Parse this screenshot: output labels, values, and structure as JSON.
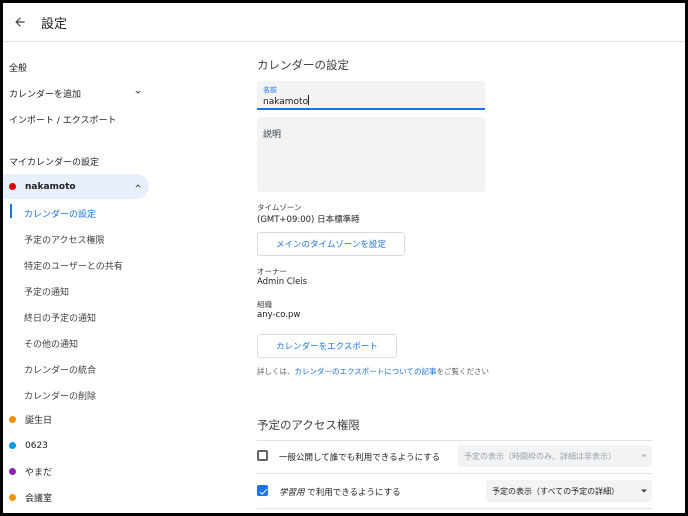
{
  "header": {
    "title": "設定"
  },
  "sidebar": {
    "general": "全般",
    "add_calendar": "カレンダーを追加",
    "import_export": "インポート / エクスポート",
    "my_calendars_heading": "マイカレンダーの設定",
    "active_calendar": {
      "name": "nakamoto",
      "color": "#d50000"
    },
    "sub_items": [
      "カレンダーの設定",
      "予定のアクセス権限",
      "特定のユーザーとの共有",
      "予定の通知",
      "終日の予定の通知",
      "その他の通知",
      "カレンダーの統合",
      "カレンダーの削除"
    ],
    "calendars": [
      {
        "name": "誕生日",
        "color": "#f09300"
      },
      {
        "name": "0623",
        "color": "#039be5"
      },
      {
        "name": "やまだ",
        "color": "#8e24aa"
      },
      {
        "name": "会議室",
        "color": "#f09300"
      }
    ]
  },
  "main": {
    "calendar_settings_title": "カレンダーの設定",
    "name_label": "名前",
    "name_value": "nakamoto",
    "description_label": "説明",
    "timezone_label": "タイムゾーン",
    "timezone_value": "(GMT+09:00) 日本標準時",
    "main_timezone_button": "メインのタイムゾーンを設定",
    "owner_label": "オーナー",
    "owner_value": "Admin Cleis",
    "org_label": "組織",
    "org_value": "any-co.pw",
    "export_button": "カレンダーをエクスポート",
    "help_prefix": "詳しくは、",
    "help_link": "カレンダーのエクスポートについての記事",
    "help_suffix": "をご覧ください",
    "access_title": "予定のアクセス権限",
    "public_checkbox_label": "一般公開して誰でも利用できるようにする",
    "public_select_value": "予定の表示（時間枠のみ、詳細は非表示）",
    "org_checkbox_label_italic": "学習用",
    "org_checkbox_label_rest": " で利用できるようにする",
    "org_select_value": "予定の表示（すべての予定の詳細）"
  }
}
